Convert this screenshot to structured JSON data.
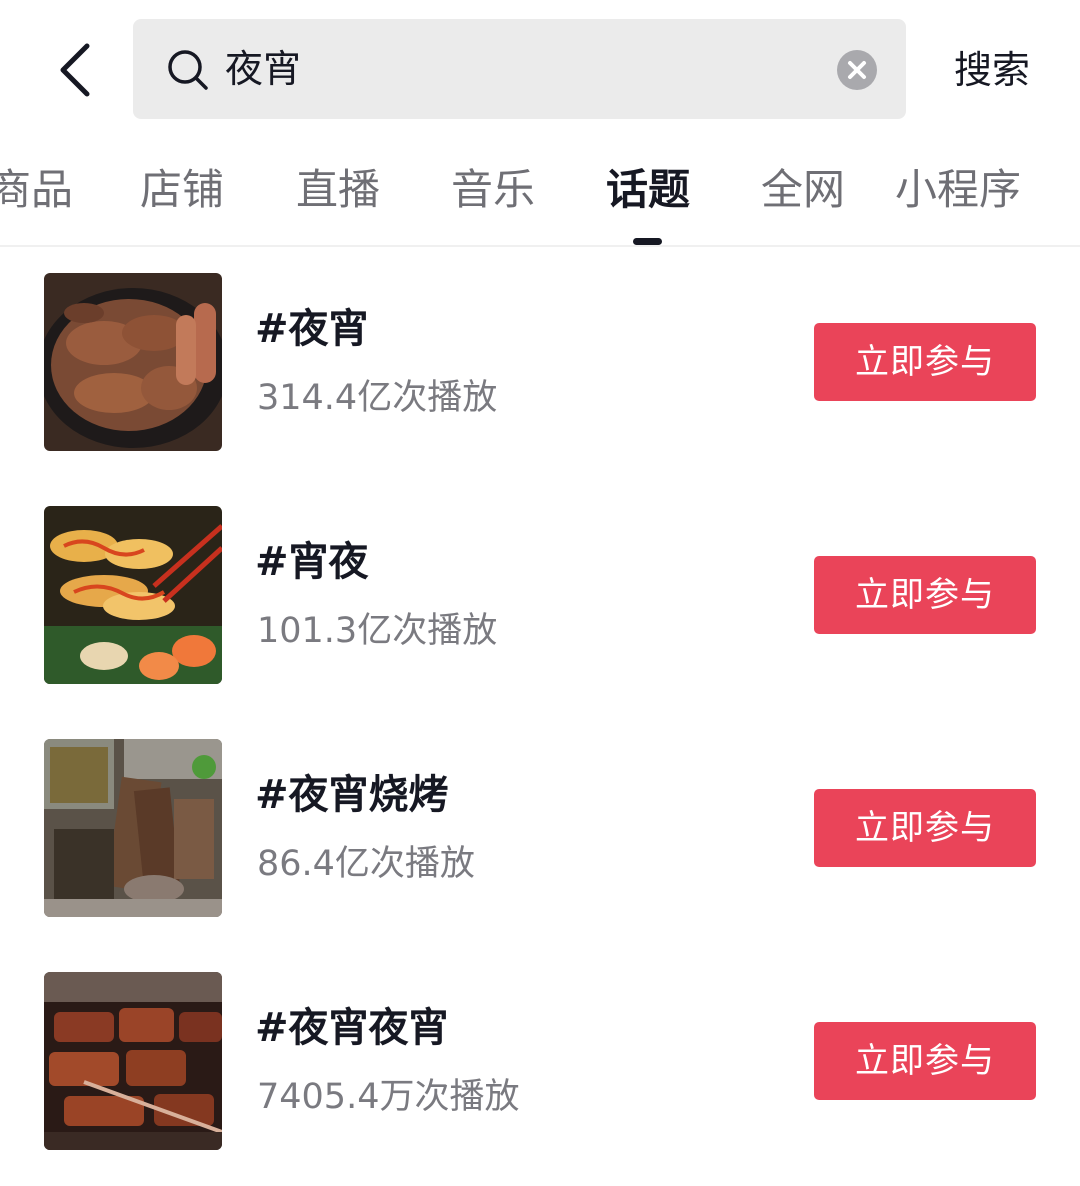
{
  "search": {
    "query": "夜宵",
    "action_label": "搜索"
  },
  "tabs": [
    {
      "label": "商品",
      "active": false
    },
    {
      "label": "店铺",
      "active": false
    },
    {
      "label": "直播",
      "active": false
    },
    {
      "label": "音乐",
      "active": false
    },
    {
      "label": "话题",
      "active": true
    },
    {
      "label": "全网",
      "active": false
    },
    {
      "label": "小程序",
      "active": false
    }
  ],
  "topics": [
    {
      "title": "#夜宵",
      "views": "314.4亿次播放",
      "button": "立即参与",
      "thumbnail": "grilled-meat-plate-image"
    },
    {
      "title": "#宵夜",
      "views": "101.3亿次播放",
      "button": "立即参与",
      "thumbnail": "sushi-platter-image"
    },
    {
      "title": "#夜宵烧烤",
      "views": "86.4亿次播放",
      "button": "立即参与",
      "thumbnail": "bbq-skewers-tray-image"
    },
    {
      "title": "#夜宵夜宵",
      "views": "7405.4万次播放",
      "button": "立即参与",
      "thumbnail": "grilled-ribs-image"
    }
  ],
  "colors": {
    "accent": "#ea4459",
    "text_primary": "#161823",
    "text_secondary": "#7a7a80",
    "search_bg": "#ebebeb"
  }
}
